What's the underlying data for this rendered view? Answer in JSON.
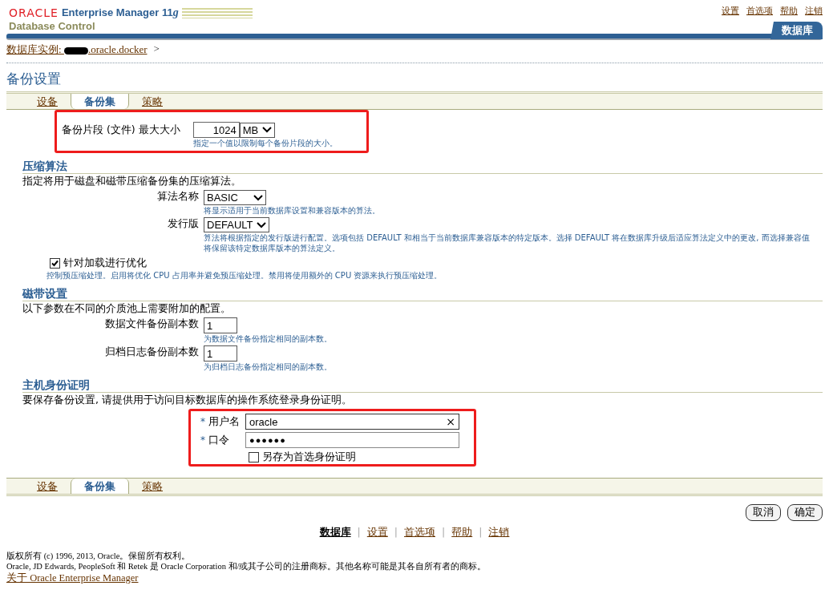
{
  "header": {
    "brand": "ORACLE",
    "product": "Enterprise Manager 11",
    "version": "g",
    "subtitle": "Database Control",
    "global_links": [
      {
        "label": "设置"
      },
      {
        "label": "首选项"
      },
      {
        "label": "帮助"
      },
      {
        "label": "注销"
      }
    ],
    "tab": {
      "label": "数据库",
      "selected": true
    }
  },
  "breadcrumb": {
    "label": "数据库实例:",
    "host": ".oracle.docker",
    "separator": ">"
  },
  "page_title": "备份设置",
  "tabs": [
    {
      "label": "设备",
      "selected": false
    },
    {
      "label": "备份集",
      "selected": true
    },
    {
      "label": "策略",
      "selected": false
    }
  ],
  "piece_size": {
    "label": "备份片段 (文件) 最大大小",
    "value": "1024",
    "unit": "MB",
    "hint": "指定一个值以限制每个备份片段的大小。"
  },
  "compression": {
    "heading": "压缩算法",
    "description": "指定将用于磁盘和磁带压缩备份集的压缩算法。",
    "fields": [
      {
        "label": "算法名称",
        "value": "BASIC",
        "hint": "将显示适用于当前数据库设置和兼容版本的算法。"
      },
      {
        "label": "发行版",
        "value": "DEFAULT",
        "hint": "算法将根据指定的发行版进行配置。选项包括 DEFAULT 和相当于当前数据库兼容版本的特定版本。选择 DEFAULT 将在数据库升级后适应算法定义中的更改, 而选择兼容值将保留该特定数据库版本的算法定义。"
      }
    ],
    "optimize": {
      "label": "针对加载进行优化",
      "checked": true,
      "hint": "控制预压缩处理。启用将优化 CPU 占用率并避免预压缩处理。禁用将使用额外的 CPU 资源来执行预压缩处理。"
    }
  },
  "tape": {
    "heading": "磁带设置",
    "description": "以下参数在不同的介质池上需要附加的配置。",
    "fields": [
      {
        "label": "数据文件备份副本数",
        "value": "1",
        "hint": "为数据文件备份指定相同的副本数。"
      },
      {
        "label": "归档日志备份副本数",
        "value": "1",
        "hint": "为归档日志备份指定相同的副本数。"
      }
    ]
  },
  "host_credentials": {
    "heading": "主机身份证明",
    "description": "要保存备份设置, 请提供用于访问目标数据库的操作系统登录身份证明。",
    "username": {
      "required_mark": "*",
      "label": "用户名",
      "value": "oracle",
      "clear": "×"
    },
    "password": {
      "required_mark": "*",
      "label": "口令",
      "value": "●●●●●●"
    },
    "save": {
      "label": "另存为首选身份证明",
      "checked": false
    }
  },
  "bottom_tabs": [
    {
      "label": "设备",
      "selected": false
    },
    {
      "label": "备份集",
      "selected": true
    },
    {
      "label": "策略",
      "selected": false
    }
  ],
  "buttons": [
    "取消",
    "确定"
  ],
  "footer_links": [
    {
      "label": "数据库",
      "selected": true
    },
    {
      "label": "设置",
      "selected": false
    },
    {
      "label": "首选项",
      "selected": false
    },
    {
      "label": "帮助",
      "selected": false
    },
    {
      "label": "注销",
      "selected": false
    }
  ],
  "footer_separator": "|",
  "copyright": [
    "版权所有 (c) 1996, 2013, Oracle。保留所有权利。",
    "Oracle, JD Edwards, PeopleSoft 和 Retek 是 Oracle Corporation 和/或其子公司的注册商标。其他名称可能是其各自所有者的商标。"
  ],
  "about_link": "关于 Oracle Enterprise Manager"
}
